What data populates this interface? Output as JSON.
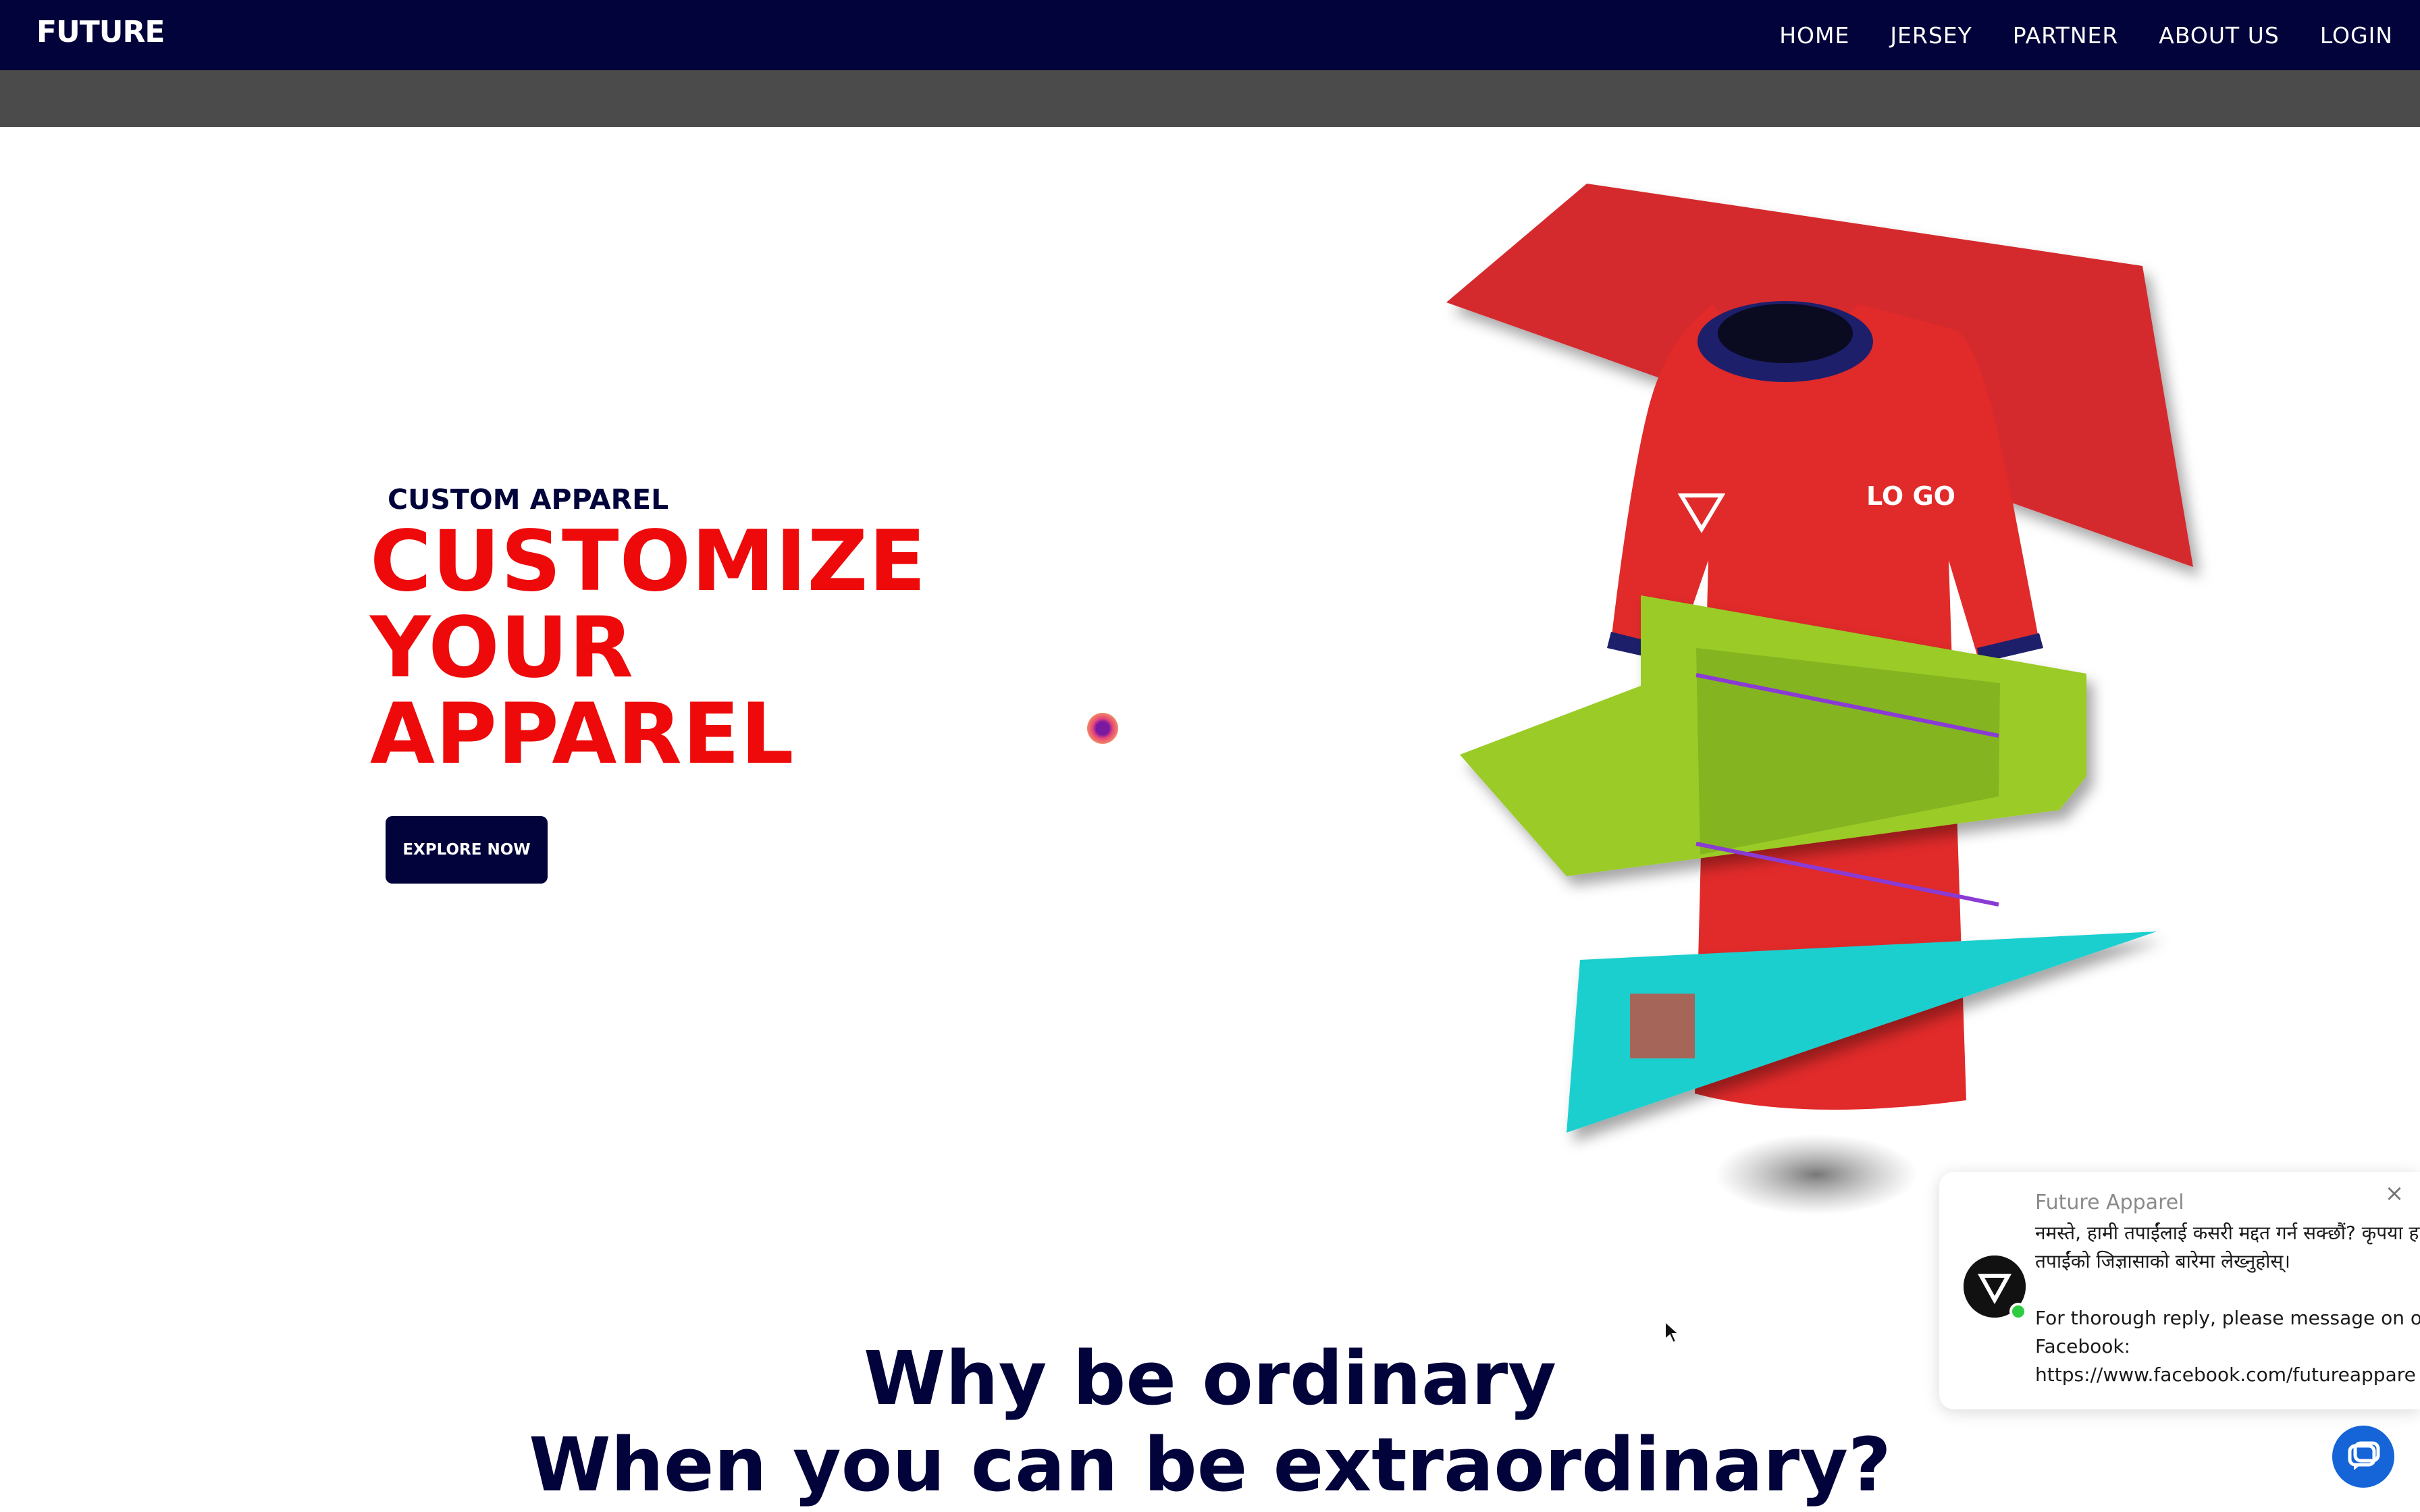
{
  "brand": {
    "logo_text": "FUTURE"
  },
  "nav": {
    "items": [
      {
        "label": "HOME"
      },
      {
        "label": "JERSEY"
      },
      {
        "label": "PARTNER"
      },
      {
        "label": "ABOUT US"
      },
      {
        "label": "LOGIN"
      }
    ]
  },
  "hero": {
    "subtitle": "CUSTOM APPAREL",
    "title_lines": [
      "CUSTOMIZE",
      "YOUR",
      "APPAREL"
    ],
    "cta_label": "EXPLORE NOW",
    "jersey_logo_text": "LO GO",
    "colors": {
      "title": "#ee0a0a",
      "navy": "#02033a",
      "jersey_red": "#e12a2a",
      "panel_green": "#9acb28",
      "panel_cyan": "#1fcfcf"
    }
  },
  "section": {
    "line1": "Why be ordinary",
    "line2": "When you can be extraordinary?"
  },
  "chat": {
    "name": "Future Apparel",
    "message_line1": "नमस्ते, हामी तपाईंलाई कसरी मद्दत गर्न सक्छौं? कृपया हाम",
    "message_line2": "तपाईंको जिज्ञासाको बारेमा लेख्नुहोस्।",
    "message_line3": "For thorough reply, please message on o",
    "message_line4": "Facebook:",
    "message_line5": "https://www.facebook.com/futureappare",
    "close_icon": "close-icon",
    "launcher_icon": "chat-bubble-icon"
  }
}
